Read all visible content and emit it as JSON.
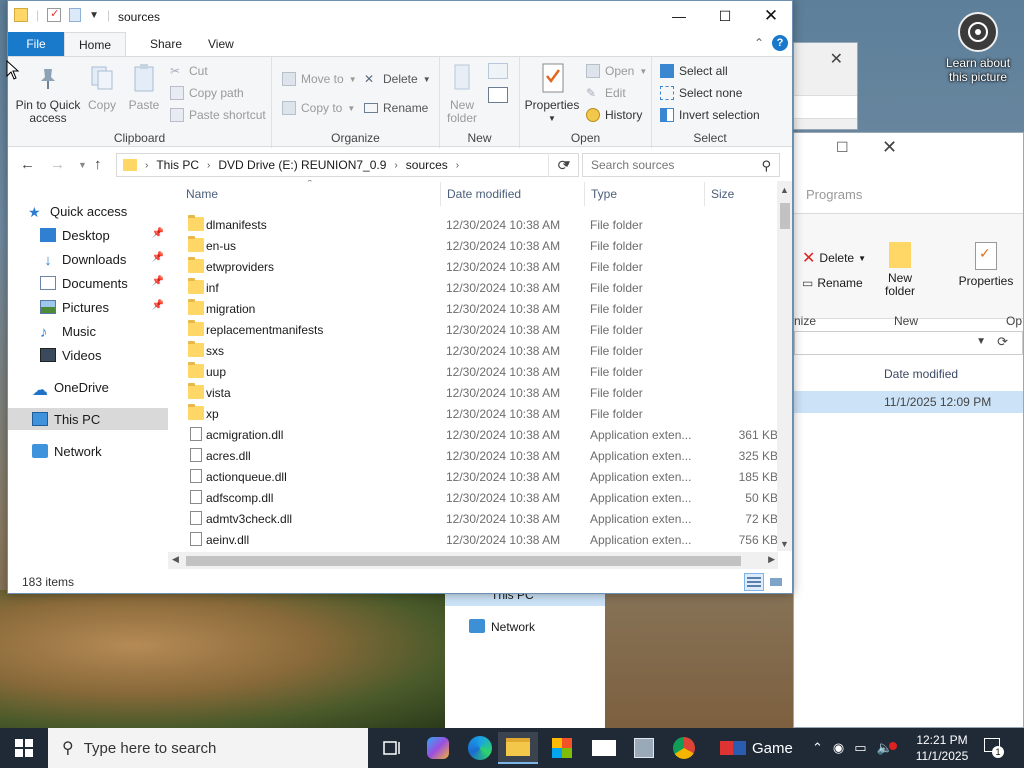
{
  "window": {
    "title": "sources"
  },
  "tabs": {
    "file": "File",
    "home": "Home",
    "share": "Share",
    "view": "View",
    "help": "?"
  },
  "ribbon": {
    "clipboard": {
      "label": "Clipboard",
      "pin_to_quick_access": "Pin to Quick access",
      "copy": "Copy",
      "paste": "Paste",
      "cut": "Cut",
      "copy_path": "Copy path",
      "paste_shortcut": "Paste shortcut"
    },
    "organize": {
      "label": "Organize",
      "move_to": "Move to",
      "copy_to": "Copy to",
      "delete": "Delete",
      "rename": "Rename"
    },
    "new": {
      "label": "New",
      "new_folder": "New folder"
    },
    "open": {
      "label": "Open",
      "properties": "Properties",
      "open": "Open",
      "edit": "Edit",
      "history": "History"
    },
    "select": {
      "label": "Select",
      "select_all": "Select all",
      "select_none": "Select none",
      "invert_selection": "Invert selection"
    }
  },
  "address": {
    "crumbs": [
      "This PC",
      "DVD Drive (E:) REUNION7_0.9",
      "sources"
    ],
    "search_placeholder": "Search sources"
  },
  "nav": {
    "quick_access": "Quick access",
    "desktop": "Desktop",
    "downloads": "Downloads",
    "documents": "Documents",
    "pictures": "Pictures",
    "music": "Music",
    "videos": "Videos",
    "onedrive": "OneDrive",
    "this_pc": "This PC",
    "network": "Network"
  },
  "columns": {
    "name": "Name",
    "date_modified": "Date modified",
    "type": "Type",
    "size": "Size"
  },
  "files": [
    {
      "name": "dlmanifests",
      "date": "12/30/2024 10:38 AM",
      "type": "File folder",
      "size": "",
      "kind": "folder"
    },
    {
      "name": "en-us",
      "date": "12/30/2024 10:38 AM",
      "type": "File folder",
      "size": "",
      "kind": "folder"
    },
    {
      "name": "etwproviders",
      "date": "12/30/2024 10:38 AM",
      "type": "File folder",
      "size": "",
      "kind": "folder"
    },
    {
      "name": "inf",
      "date": "12/30/2024 10:38 AM",
      "type": "File folder",
      "size": "",
      "kind": "folder"
    },
    {
      "name": "migration",
      "date": "12/30/2024 10:38 AM",
      "type": "File folder",
      "size": "",
      "kind": "folder"
    },
    {
      "name": "replacementmanifests",
      "date": "12/30/2024 10:38 AM",
      "type": "File folder",
      "size": "",
      "kind": "folder"
    },
    {
      "name": "sxs",
      "date": "12/30/2024 10:38 AM",
      "type": "File folder",
      "size": "",
      "kind": "folder"
    },
    {
      "name": "uup",
      "date": "12/30/2024 10:38 AM",
      "type": "File folder",
      "size": "",
      "kind": "folder"
    },
    {
      "name": "vista",
      "date": "12/30/2024 10:38 AM",
      "type": "File folder",
      "size": "",
      "kind": "folder"
    },
    {
      "name": "xp",
      "date": "12/30/2024 10:38 AM",
      "type": "File folder",
      "size": "",
      "kind": "folder"
    },
    {
      "name": "acmigration.dll",
      "date": "12/30/2024 10:38 AM",
      "type": "Application exten...",
      "size": "361 KB",
      "kind": "dll"
    },
    {
      "name": "acres.dll",
      "date": "12/30/2024 10:38 AM",
      "type": "Application exten...",
      "size": "325 KB",
      "kind": "dll"
    },
    {
      "name": "actionqueue.dll",
      "date": "12/30/2024 10:38 AM",
      "type": "Application exten...",
      "size": "185 KB",
      "kind": "dll"
    },
    {
      "name": "adfscomp.dll",
      "date": "12/30/2024 10:38 AM",
      "type": "Application exten...",
      "size": "50 KB",
      "kind": "dll"
    },
    {
      "name": "admtv3check.dll",
      "date": "12/30/2024 10:38 AM",
      "type": "Application exten...",
      "size": "72 KB",
      "kind": "dll"
    },
    {
      "name": "aeinv.dll",
      "date": "12/30/2024 10:38 AM",
      "type": "Application exten...",
      "size": "756 KB",
      "kind": "dll"
    }
  ],
  "status": {
    "item_count": "183 items"
  },
  "background": {
    "programs_label": "Programs",
    "delete": "Delete",
    "rename": "Rename",
    "new_folder": "New folder",
    "properties": "Properties",
    "new_group": "New",
    "organize_fragment": "nize",
    "open_fragment": "Op",
    "date_modified": "Date modified",
    "row_date": "11/1/2025 12:09 PM",
    "this_pc": "This PC",
    "network": "Network"
  },
  "desktop_icon": {
    "label": "Learn about this picture"
  },
  "taskbar": {
    "search_placeholder": "Type here to search",
    "game_label": "Game",
    "time": "12:21 PM",
    "date": "11/1/2025",
    "notification_count": "1"
  },
  "colors": {
    "accent": "#1979ca",
    "selection": "#cce3f7",
    "folder": "#ffd766"
  }
}
